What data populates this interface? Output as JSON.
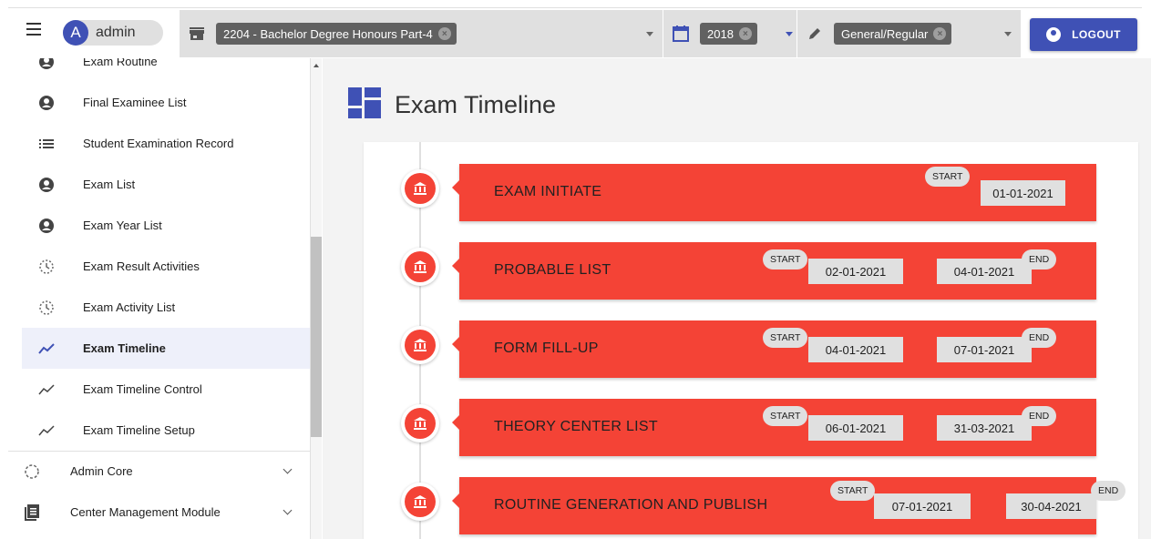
{
  "header": {
    "user_initial": "A",
    "user_name": "admin",
    "program": "2204 - Bachelor Degree Honours Part-4",
    "year": "2018",
    "exam_type": "General/Regular",
    "logout_label": "LOGOUT"
  },
  "sidebar": {
    "items": [
      {
        "label": "Exam Routine",
        "icon": "account-circle-icon"
      },
      {
        "label": "Final Examinee List",
        "icon": "account-circle-icon"
      },
      {
        "label": "Student Examination Record",
        "icon": "list-icon"
      },
      {
        "label": "Exam List",
        "icon": "account-circle-icon"
      },
      {
        "label": "Exam Year List",
        "icon": "account-circle-icon"
      },
      {
        "label": "Exam Result Activities",
        "icon": "clock-dashed-icon"
      },
      {
        "label": "Exam Activity List",
        "icon": "clock-dashed-icon"
      },
      {
        "label": "Exam Timeline",
        "icon": "timeline-icon"
      },
      {
        "label": "Exam Timeline Control",
        "icon": "timeline-icon"
      },
      {
        "label": "Exam Timeline Setup",
        "icon": "timeline-icon"
      }
    ],
    "modules": [
      {
        "label": "Admin Core",
        "icon": "circle-dashed-icon"
      },
      {
        "label": "Center Management Module",
        "icon": "document-list-icon"
      }
    ],
    "active_item": "Exam Timeline"
  },
  "main": {
    "title": "Exam Timeline",
    "start_tag": "START",
    "end_tag": "END",
    "events": [
      {
        "title": "EXAM INITIATE",
        "start": "01-01-2021",
        "end": ""
      },
      {
        "title": "PROBABLE LIST",
        "start": "02-01-2021",
        "end": "04-01-2021"
      },
      {
        "title": "FORM FILL-UP",
        "start": "04-01-2021",
        "end": "07-01-2021"
      },
      {
        "title": "THEORY CENTER LIST",
        "start": "06-01-2021",
        "end": "31-03-2021"
      },
      {
        "title": "ROUTINE GENERATION AND PUBLISH",
        "start": "07-01-2021",
        "end": "30-04-2021"
      }
    ]
  },
  "colors": {
    "primary": "#3f51b5",
    "event": "#f44336",
    "chip": "#616161"
  }
}
